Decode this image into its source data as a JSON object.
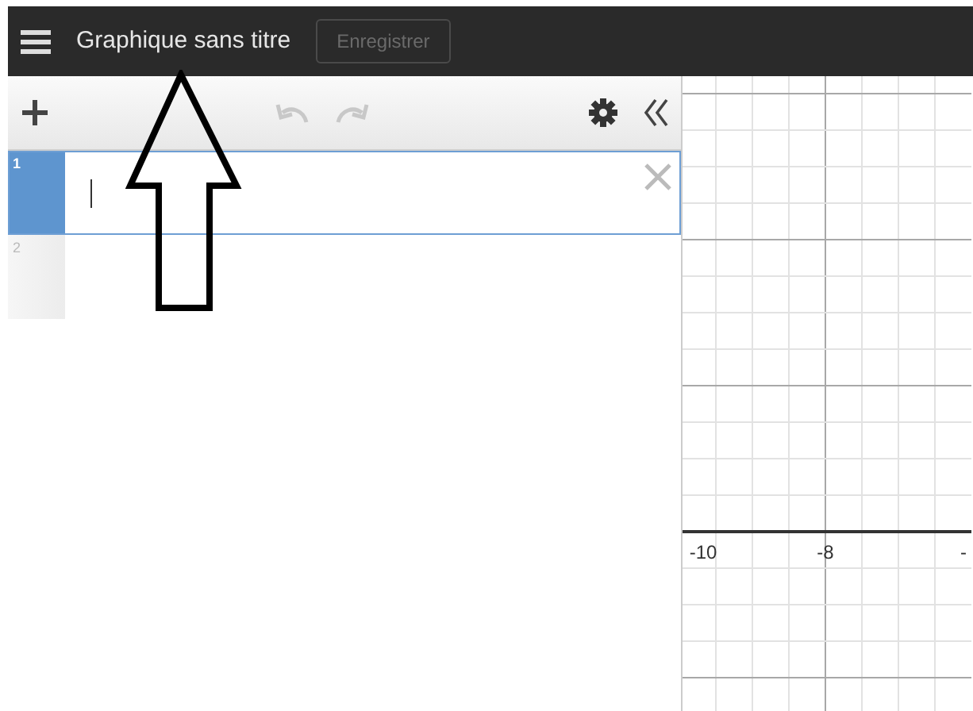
{
  "title": "Graphique sans titre",
  "save_button": {
    "label": "Enregistrer",
    "disabled": true
  },
  "toolbar": {
    "undo_disabled": true,
    "redo_disabled": true
  },
  "expressions": [
    {
      "number": "1",
      "selected": true
    },
    {
      "number": "2",
      "selected": false
    }
  ],
  "graph": {
    "x_labels": [
      "-10",
      "-8",
      "-"
    ]
  }
}
